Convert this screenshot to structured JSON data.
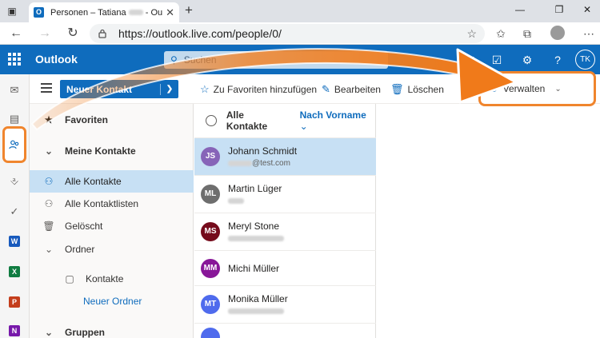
{
  "browser": {
    "tab_title": "Personen – Tatiana",
    "tab_title_suffix": "- Outlook",
    "url": "https://outlook.live.com/people/0/"
  },
  "header": {
    "app_name": "Outlook",
    "search_placeholder": "Suchen",
    "avatar_initials": "TK"
  },
  "command_bar": {
    "new_contact_label": "Neuer Kontakt",
    "favorite_label": "Zu Favoriten hinzufügen",
    "edit_label": "Bearbeiten",
    "delete_label": "Löschen",
    "manage_label": "Verwalten"
  },
  "folders": {
    "favorites": "Favoriten",
    "my_contacts": "Meine Kontakte",
    "all_contacts": "Alle Kontakte",
    "all_lists": "Alle Kontaktlisten",
    "deleted": "Gelöscht",
    "folder": "Ordner",
    "contacts": "Kontakte",
    "new_folder": "Neuer Ordner",
    "groups": "Gruppen"
  },
  "contact_list": {
    "title": "Alle Kontakte",
    "sort_label": "Nach Vorname",
    "contacts": [
      {
        "initials": "JS",
        "name": "Johann Schmidt",
        "email": "@test.com",
        "color": "#8764b8"
      },
      {
        "initials": "ML",
        "name": "Martin Lüger",
        "email": "",
        "color": "#6e6e6e"
      },
      {
        "initials": "MS",
        "name": "Meryl Stone",
        "email": "",
        "color": "#750b1c"
      },
      {
        "initials": "MM",
        "name": "Michi Müller",
        "email": "",
        "color": "#881798"
      },
      {
        "initials": "MT",
        "name": "Monika Müller",
        "email": "",
        "color": "#4f6bed"
      }
    ]
  },
  "colors": {
    "brand_blue": "#0f6cbd",
    "highlight_orange": "#f0852d",
    "selection": "#c7e0f4"
  }
}
